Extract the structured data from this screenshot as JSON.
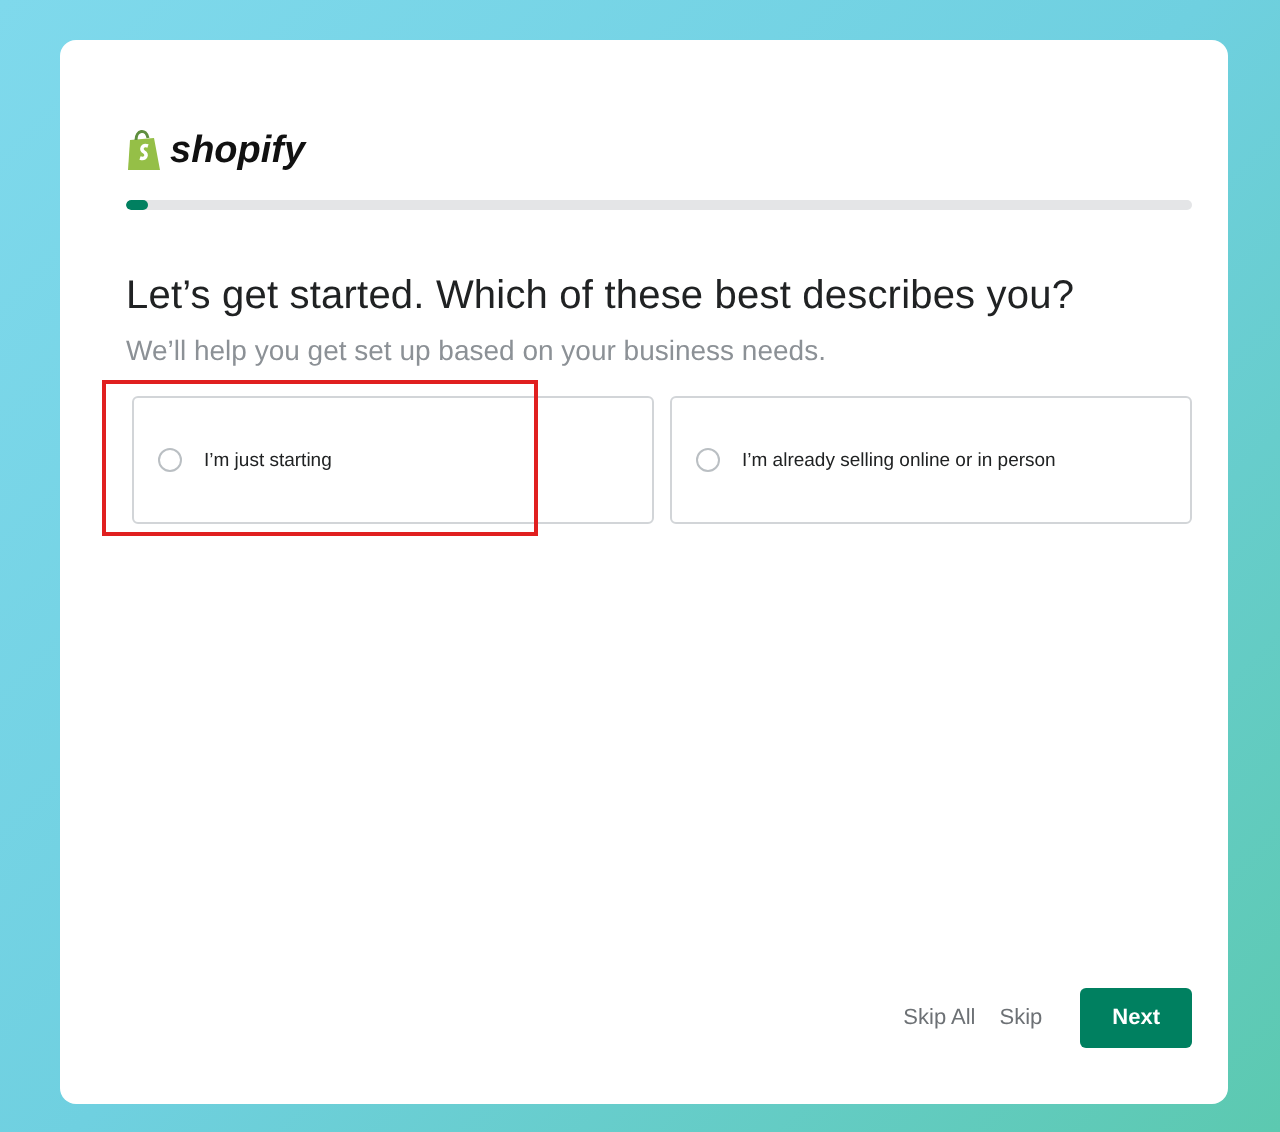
{
  "logo": {
    "text": "shopify"
  },
  "progress": {
    "level": 0.02
  },
  "heading": "Let’s get started. Which of these best describes you?",
  "subtitle": "We’ll help you get set up based on your business needs.",
  "options": [
    {
      "label": "I’m just starting",
      "selected": false,
      "highlighted": true
    },
    {
      "label": "I’m already selling online or in person",
      "selected": false,
      "highlighted": false
    }
  ],
  "actions": [
    {
      "label": "Skip All",
      "kind": "plain"
    },
    {
      "label": "Skip",
      "kind": "plain"
    },
    {
      "label": "Next",
      "kind": "primary"
    }
  ]
}
